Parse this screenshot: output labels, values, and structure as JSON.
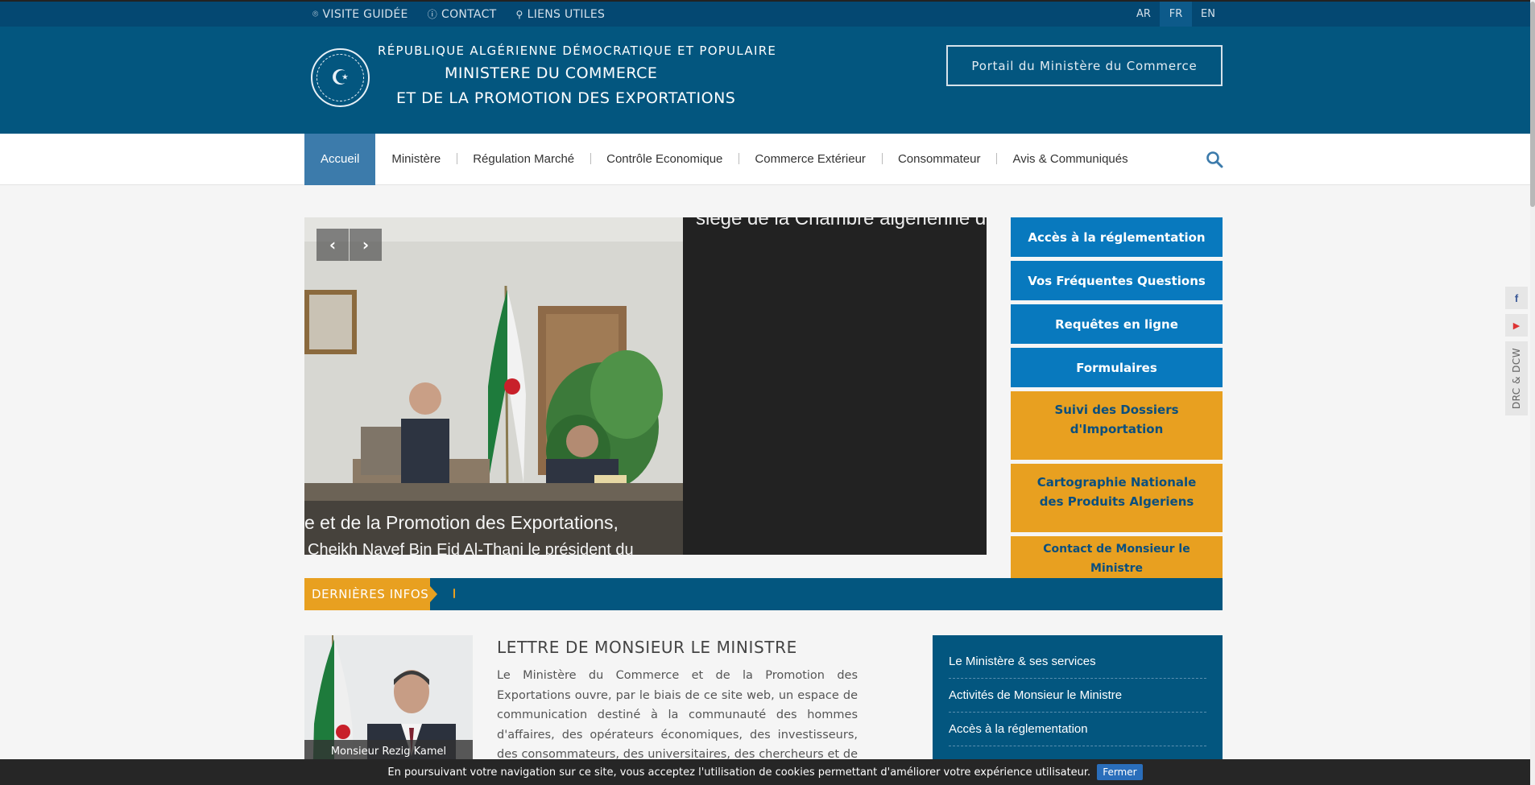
{
  "topbar": {
    "links": [
      {
        "label": "VISITE GUIDÉE",
        "icon": "map-pin-icon"
      },
      {
        "label": "CONTACT",
        "icon": "info-icon"
      },
      {
        "label": "LIENS UTILES",
        "icon": "link-icon"
      }
    ],
    "languages": [
      "AR",
      "FR",
      "EN"
    ],
    "active_language": "FR"
  },
  "header": {
    "republic": "RÉPUBLIQUE ALGÉRIENNE DÉMOCRATIQUE ET POPULAIRE",
    "ministry_line1": "MINISTERE DU COMMERCE",
    "ministry_line2": "ET DE LA PROMOTION DES EXPORTATIONS",
    "portal_button": "Portail du Ministère du Commerce"
  },
  "nav": {
    "items": [
      "Accueil",
      "Ministère",
      "Régulation Marché",
      "Contrôle Economique",
      "Commerce Extérieur",
      "Consommateur",
      "Avis & Communiqués"
    ],
    "active": "Accueil"
  },
  "slider": {
    "headline_top": "siège de la Chambre algérienne de co",
    "caption_line1": "e et de la Promotion des Exportations,",
    "caption_line2": "Cheikh Nayef Bin Eid Al-Thani le président du"
  },
  "quick_links": [
    {
      "label": "Accès à la réglementation",
      "style": "blue"
    },
    {
      "label": "Vos Fréquentes Questions",
      "style": "blue"
    },
    {
      "label": "Requêtes en ligne",
      "style": "blue"
    },
    {
      "label": "Formulaires",
      "style": "blue"
    },
    {
      "label": "Suivi des Dossiers d'Importation",
      "style": "orange"
    },
    {
      "label": "Cartographie Nationale des Produits Algeriens",
      "style": "orange"
    },
    {
      "label": "Contact de Monsieur le Ministre kamel.rezig@commerce.gov.dz",
      "style": "orange"
    }
  ],
  "ticker": {
    "label": "DERNIÈRES INFOS"
  },
  "minister": {
    "name": "Monsieur Rezig Kamel",
    "letter_title": "LETTRE DE MONSIEUR LE MINISTRE",
    "letter_body": "Le Ministère du Commerce et de la Promotion des Exportations ouvre, par le biais de ce site web, un espace de communication destiné à la communauté des hommes d'affaires, des opérateurs économiques, des investisseurs, des consommateurs, des universitaires, des chercheurs et de tous"
  },
  "side_list": [
    "Le Ministère & ses services",
    "Activités de Monsieur le Ministre",
    "Accès à la réglementation"
  ],
  "social": {
    "icons": [
      "facebook-icon",
      "youtube-icon"
    ],
    "drc_label": "DRC & DCW"
  },
  "cookie": {
    "text": "En poursuivant votre navigation sur ce site, vous acceptez l'utilisation de cookies permettant d'améliorer votre expérience utilisateur.",
    "button": "Fermer"
  },
  "colors": {
    "primary": "#03567f",
    "accent": "#e8a020",
    "button_blue": "#0879be"
  }
}
